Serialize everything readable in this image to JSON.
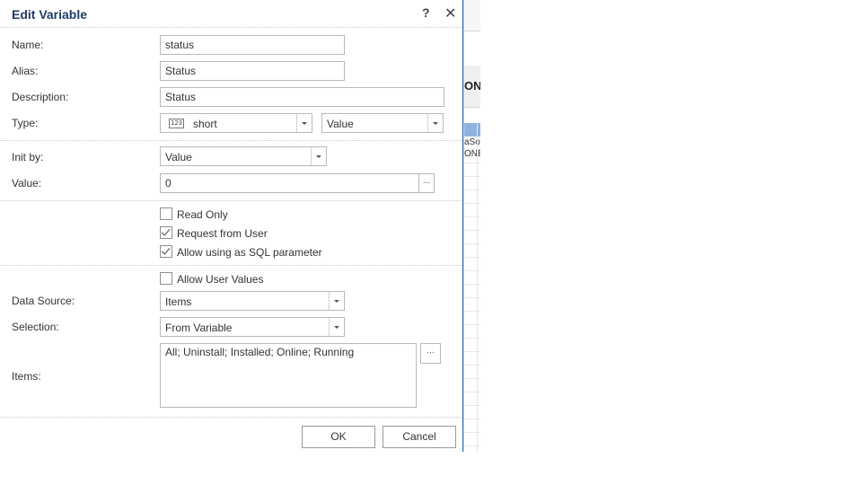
{
  "dialog": {
    "title": "Edit Variable",
    "help_label": "?",
    "close_label": "✕"
  },
  "fields": {
    "name": {
      "label": "Name:",
      "value": "status"
    },
    "alias": {
      "label": "Alias:",
      "value": "Status"
    },
    "description": {
      "label": "Description:",
      "value": "Status"
    },
    "type": {
      "label": "Type:",
      "icon_text": "123",
      "icon": "numeric-type-icon",
      "value": "short",
      "kind": "Value"
    },
    "init_by": {
      "label": "Init by:",
      "value": "Value"
    },
    "value": {
      "label": "Value:",
      "value": "0",
      "browse_label": "..."
    }
  },
  "options": {
    "read_only": {
      "label": "Read Only",
      "checked": false
    },
    "request_from_user": {
      "label": "Request from User",
      "checked": true
    },
    "allow_sql_param": {
      "label": "Allow using as SQL parameter",
      "checked": true
    },
    "allow_user_values": {
      "label": "Allow User Values",
      "checked": false
    }
  },
  "data_source": {
    "label": "Data Source:",
    "value": "Items"
  },
  "selection": {
    "label": "Selection:",
    "value": "From Variable"
  },
  "items": {
    "label": "Items:",
    "value": "All; Uninstall; Installed; Online; Running",
    "browse_label": "..."
  },
  "buttons": {
    "ok": "OK",
    "cancel": "Cancel"
  },
  "background": {
    "header_fragment": "ON",
    "cell_line1": "aSo",
    "cell_line2": "ONE"
  },
  "colors": {
    "title": "#1f3b66",
    "dialog_border": "#2d6bb1",
    "highlight_row": "#8fb3e0"
  }
}
